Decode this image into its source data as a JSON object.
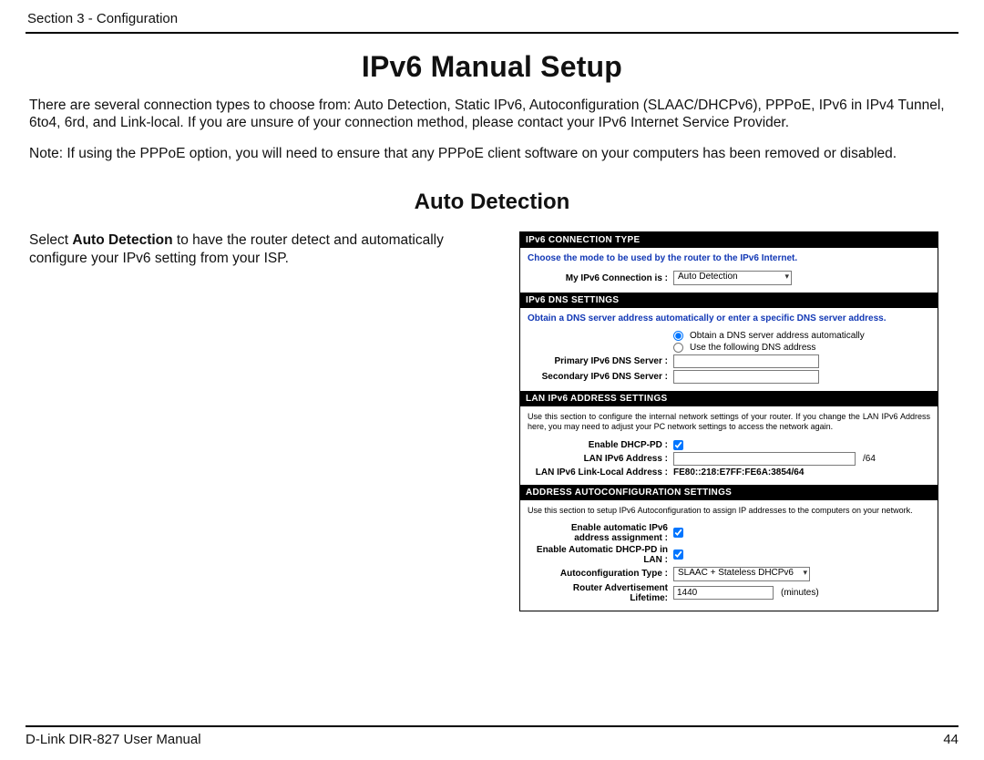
{
  "header": {
    "section": "Section 3 - Configuration"
  },
  "title": "IPv6 Manual Setup",
  "intro1": "There are several connection types to choose from: Auto Detection, Static IPv6, Autoconfiguration (SLAAC/DHCPv6), PPPoE, IPv6 in IPv4 Tunnel, 6to4, 6rd, and Link-local. If you are unsure of your connection method, please contact your IPv6 Internet Service Provider.",
  "intro2": "Note: If using the PPPoE option, you will need to ensure that any PPPoE client software on your computers has been removed or disabled.",
  "subtitle": "Auto Detection",
  "left": {
    "pre": "Select ",
    "bold": "Auto Detection",
    "post": " to have the router detect and automatically configure your IPv6 setting from your ISP."
  },
  "panel": {
    "sec1": {
      "head": "IPv6 CONNECTION TYPE",
      "hint": "Choose the mode to be used by the router to the IPv6 Internet.",
      "label": "My IPv6 Connection is :",
      "value": "Auto Detection"
    },
    "sec2": {
      "head": "IPv6 DNS SETTINGS",
      "hint": "Obtain a DNS server address automatically or enter a specific DNS server address.",
      "opt1": "Obtain a DNS server address automatically",
      "opt2": "Use the following DNS address",
      "primary_label": "Primary IPv6 DNS Server :",
      "secondary_label": "Secondary IPv6 DNS Server :"
    },
    "sec3": {
      "head": "LAN IPv6 ADDRESS SETTINGS",
      "hint": "Use this section to configure the internal network settings of your router. If you change the LAN IPv6 Address here, you may need to adjust your PC network settings to access the network again.",
      "dhcppd_label": "Enable DHCP-PD :",
      "lanaddr_label": "LAN IPv6 Address :",
      "lanaddr_suffix": "/64",
      "linklocal_label": "LAN IPv6 Link-Local Address :",
      "linklocal_value": "FE80::218:E7FF:FE6A:3854/64"
    },
    "sec4": {
      "head": "ADDRESS AUTOCONFIGURATION SETTINGS",
      "hint": "Use this section to setup IPv6 Autoconfiguration to assign IP addresses to the computers on your network.",
      "autoassign_label1": "Enable automatic IPv6",
      "autoassign_label2": "address assignment :",
      "autodhcppd_label1": "Enable Automatic DHCP-PD in",
      "autodhcppd_label2": "LAN :",
      "autotype_label": "Autoconfiguration Type :",
      "autotype_value": "SLAAC + Stateless DHCPv6",
      "ralife_label1": "Router Advertisement",
      "ralife_label2": "Lifetime:",
      "ralife_value": "1440",
      "ralife_suffix": "(minutes)"
    }
  },
  "footer": {
    "left": "D-Link DIR-827 User Manual",
    "right": "44"
  }
}
